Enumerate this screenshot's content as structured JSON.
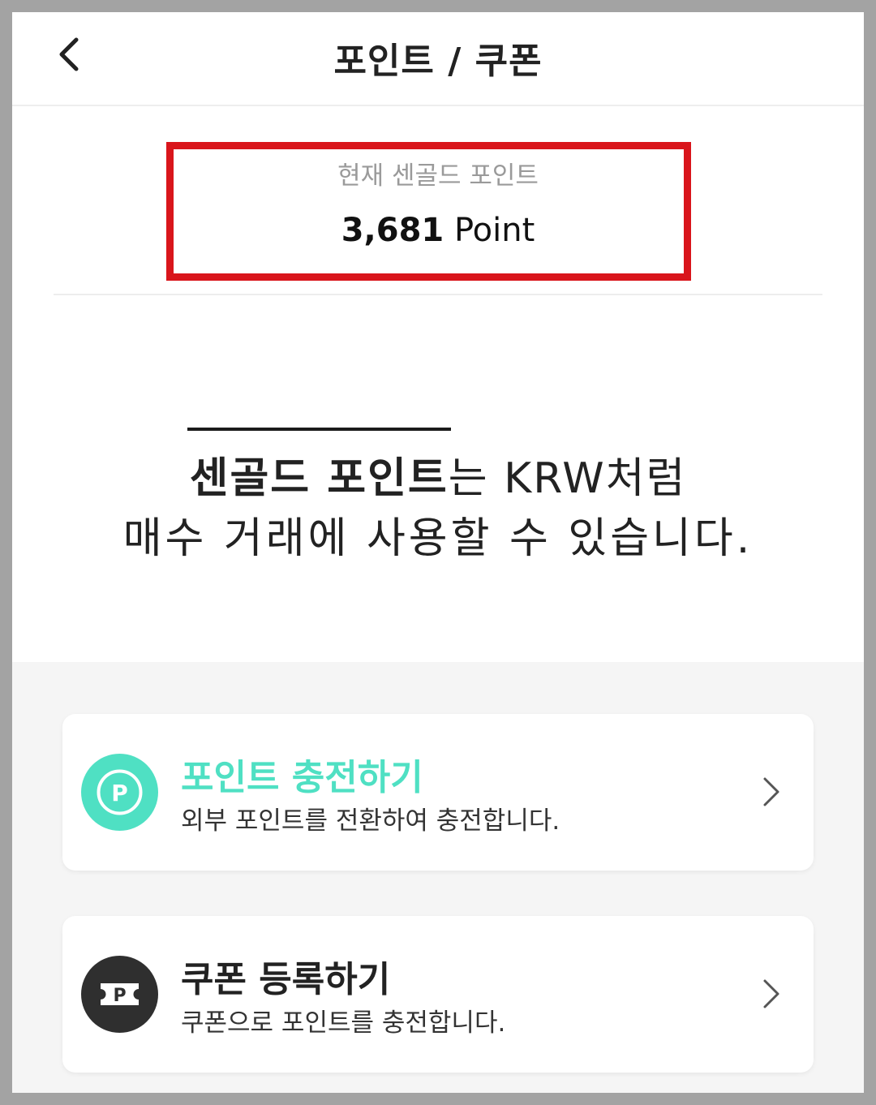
{
  "header": {
    "title": "포인트 / 쿠폰",
    "back_icon": "chevron-left-icon"
  },
  "points": {
    "label": "현재 센골드 포인트",
    "value": "3,681",
    "unit": "Point",
    "highlight_color": "#d9151b"
  },
  "headline": {
    "strong": "센골드 포인트",
    "line1_rest": "는 KRW처럼",
    "line2": "매수 거래에 사용할 수 있습니다."
  },
  "cards": [
    {
      "title": "포인트 충전하기",
      "desc": "외부 포인트를 전환하여 충전합니다.",
      "icon": "point-coin-icon",
      "icon_letter": "P",
      "accent": "#4fe0c3"
    },
    {
      "title": "쿠폰 등록하기",
      "desc": "쿠폰으로 포인트를 충전합니다.",
      "icon": "coupon-ticket-icon",
      "icon_letter": "P",
      "accent": "#2f2f2f"
    }
  ]
}
